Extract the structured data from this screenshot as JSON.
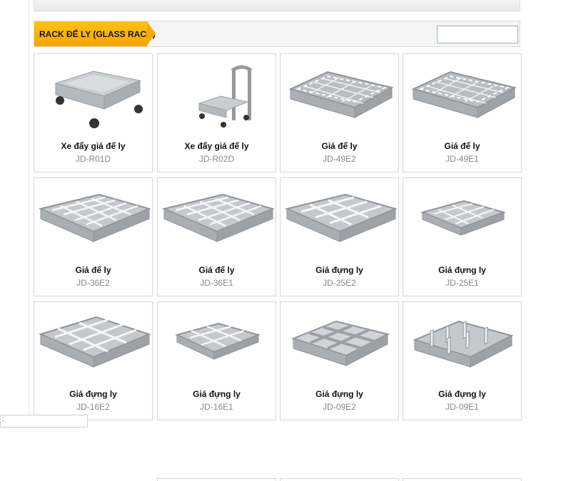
{
  "section": {
    "title": "RACK ĐỂ LY (GLASS RACK)",
    "search_value": ""
  },
  "products": [
    {
      "name": "Xe đẩy giá để ly",
      "code": "JD-R01D",
      "img": "dolly"
    },
    {
      "name": "Xe đẩy giá để ly",
      "code": "JD-R02D",
      "img": "dolly-handle"
    },
    {
      "name": "Giá để ly",
      "code": "JD-49E2",
      "img": "rack"
    },
    {
      "name": "Giá để ly",
      "code": "JD-49E1",
      "img": "rack"
    },
    {
      "name": "Giá để ly",
      "code": "JD-36E2",
      "img": "rack"
    },
    {
      "name": "Giá để ly",
      "code": "JD-36E1",
      "img": "rack"
    },
    {
      "name": "Giá đựng ly",
      "code": "JD-25E2",
      "img": "rack"
    },
    {
      "name": "Giá đựng ly",
      "code": "JD-25E1",
      "img": "rack-small"
    },
    {
      "name": "Giá đựng ly",
      "code": "JD-16E2",
      "img": "rack"
    },
    {
      "name": "Giá đựng ly",
      "code": "JD-16E1",
      "img": "rack-small"
    },
    {
      "name": "Giá đựng ly",
      "code": "JD-09E2",
      "img": "rack"
    },
    {
      "name": "Giá đựng ly",
      "code": "JD-09E1",
      "img": "rack"
    }
  ],
  "status_text": ":"
}
